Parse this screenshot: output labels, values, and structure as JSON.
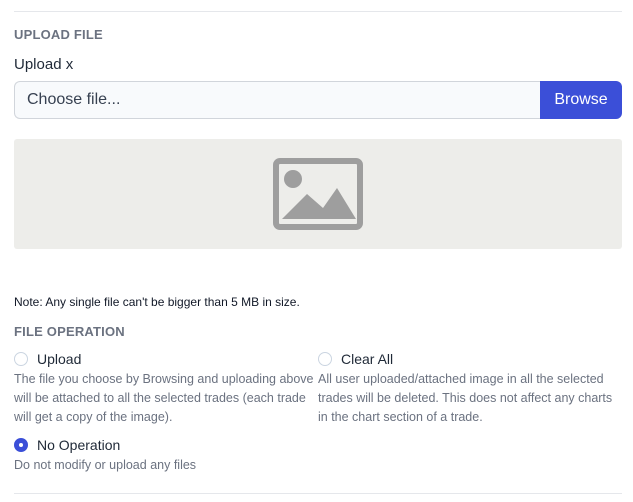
{
  "section_upload": {
    "title": "UPLOAD FILE",
    "field_label": "Upload x",
    "placeholder": "Choose file...",
    "browse_label": "Browse",
    "preview_icon": "image-placeholder-icon"
  },
  "note": "Note: Any single file can't be bigger than 5 MB in size.",
  "section_operation": {
    "title": "FILE OPERATION",
    "options": [
      {
        "label": "Upload",
        "description": "The file you choose by Browsing and uploading above will be attached to all the selected trades (each trade will get a copy of the image).",
        "selected": false
      },
      {
        "label": "Clear All",
        "description": "All user uploaded/attached image in all the selected trades will be deleted. This does not affect any charts in the chart section of a trade.",
        "selected": false
      },
      {
        "label": "No Operation",
        "description": "Do not modify or upload any files",
        "selected": true
      }
    ]
  },
  "colors": {
    "accent": "#3b4fd8",
    "preview_bg": "#ededea",
    "muted_text": "#6b7280"
  }
}
